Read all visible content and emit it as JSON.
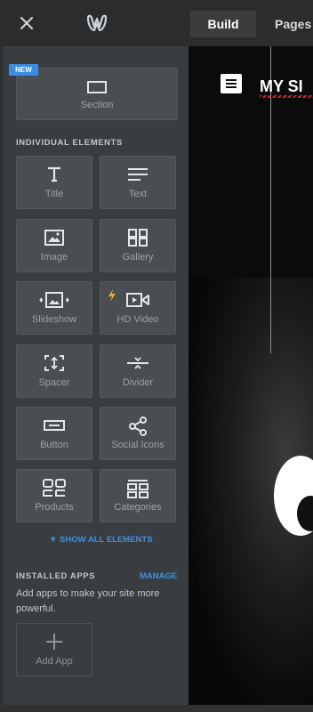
{
  "topbar": {
    "close_icon": "close-icon",
    "logo_icon": "weebly-logo-icon",
    "tabs": [
      {
        "label": "Build",
        "active": true
      },
      {
        "label": "Pages",
        "active": false
      }
    ]
  },
  "panel": {
    "section_tile": {
      "badge": "NEW",
      "label": "Section",
      "icon": "section-icon"
    },
    "individual_heading": "INDIVIDUAL ELEMENTS",
    "elements": [
      {
        "label": "Title",
        "icon": "title-icon"
      },
      {
        "label": "Text",
        "icon": "text-icon"
      },
      {
        "label": "Image",
        "icon": "image-icon"
      },
      {
        "label": "Gallery",
        "icon": "gallery-icon"
      },
      {
        "label": "Slideshow",
        "icon": "slideshow-icon"
      },
      {
        "label": "HD Video",
        "icon": "hd-video-icon"
      },
      {
        "label": "Spacer",
        "icon": "spacer-icon"
      },
      {
        "label": "Divider",
        "icon": "divider-icon"
      },
      {
        "label": "Button",
        "icon": "button-icon"
      },
      {
        "label": "Social Icons",
        "icon": "share-icon"
      },
      {
        "label": "Products",
        "icon": "products-icon"
      },
      {
        "label": "Categories",
        "icon": "categories-icon"
      }
    ],
    "show_all": "SHOW ALL ELEMENTS",
    "installed_heading": "INSTALLED APPS",
    "manage": "MANAGE",
    "apps_description": "Add apps to make your site more powerful.",
    "add_app": "Add App"
  },
  "canvas": {
    "site_title": "MY SI"
  },
  "colors": {
    "accent": "#3d8fe3",
    "panel_bg": "#3a3d40",
    "tile_bg": "#4a4d51",
    "topbar_bg": "#2a2c2e"
  }
}
